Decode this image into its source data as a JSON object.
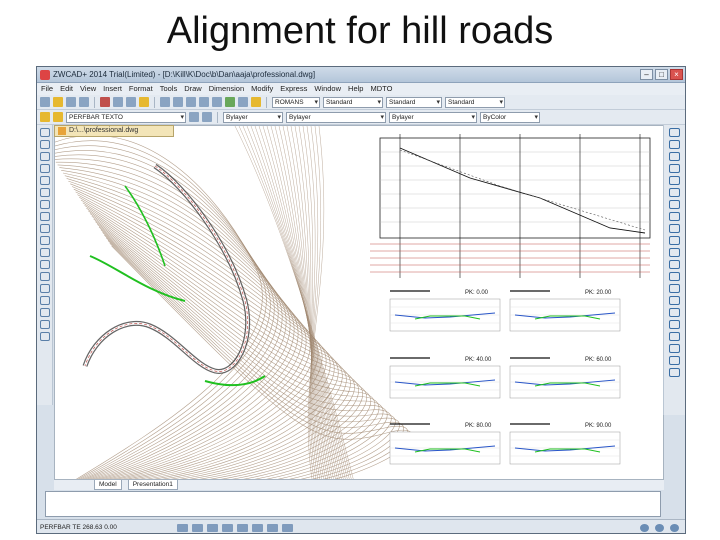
{
  "slide": {
    "title": "Alignment for hill roads"
  },
  "window": {
    "title": "ZWCAD+ 2014 Trial(Limited) - [D:\\Kill\\K\\Doc\\b\\Dan\\aaja\\professional.dwg]",
    "controls": {
      "minimize": "–",
      "maximize": "□",
      "close": "×"
    }
  },
  "menu": [
    "File",
    "Edit",
    "View",
    "Insert",
    "Format",
    "Tools",
    "Draw",
    "Dimension",
    "Modify",
    "Express",
    "Window",
    "Help",
    "MDTO"
  ],
  "toolbar": {
    "text_style": "ROMANS",
    "dim_style": "Standard",
    "table_style": "Standard",
    "multileader_style": "Standard",
    "layer": "PERFBAR TEXTO",
    "color": "Bylayer",
    "linetype": "Bylayer",
    "lineweight": "Bylayer",
    "plot_style": "ByColor"
  },
  "document_tab": {
    "label": "D:\\...\\professional.dwg"
  },
  "sheet_tabs": [
    "Model",
    "Presentation1"
  ],
  "cross_sections": {
    "labels": [
      "PK: 0.00",
      "PK: 20.00",
      "PK: 40.00",
      "PK: 60.00",
      "PK: 80.00",
      "PK: 90.00"
    ]
  },
  "status": {
    "coordinates": "PERFBAR TE  268.63  0.00"
  },
  "colors": {
    "contour": "#a08870",
    "road": "#20c020",
    "accent": "#c0504d",
    "window_chrome": "#d7e0ea"
  }
}
